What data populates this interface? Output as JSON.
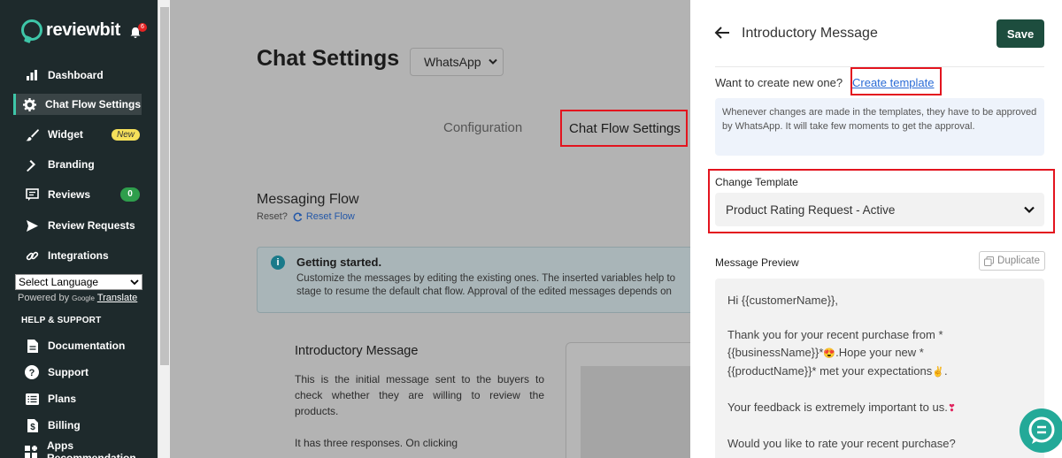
{
  "brand": {
    "name": "reviewbit",
    "notification_count": "6",
    "accent": "#3ec6a8"
  },
  "sidebar": {
    "items": [
      {
        "label": "Dashboard",
        "icon": "bar-chart-icon"
      },
      {
        "label": "Chat Flow Settings",
        "icon": "gear-icon"
      },
      {
        "label": "Widget",
        "icon": "brush-icon",
        "badge": "New"
      },
      {
        "label": "Branding",
        "icon": "hammer-icon"
      },
      {
        "label": "Reviews",
        "icon": "review-icon",
        "badge": "0"
      },
      {
        "label": "Review Requests",
        "icon": "send-icon"
      },
      {
        "label": "Integrations",
        "icon": "link-icon"
      }
    ],
    "language_select": "Select Language",
    "powered_by": "Powered by",
    "google": "Google",
    "translate": "Translate",
    "help_heading": "HELP & SUPPORT",
    "help_items": [
      {
        "label": "Documentation",
        "icon": "document-icon"
      },
      {
        "label": "Support",
        "icon": "help-icon"
      },
      {
        "label": "Plans",
        "icon": "list-icon"
      },
      {
        "label": "Billing",
        "icon": "dollar-icon"
      },
      {
        "label": "Apps Recommendation",
        "icon": "apps-icon"
      }
    ]
  },
  "main": {
    "title": "Chat Settings",
    "channel_select": "WhatsApp",
    "tabs": [
      {
        "label": "Configuration"
      },
      {
        "label": "Chat Flow Settings"
      }
    ],
    "section_title": "Messaging Flow",
    "reset_prefix": "Reset?",
    "reset_link": "Reset Flow",
    "info_title": "Getting started.",
    "info_line1": "Customize the messages by editing the existing ones. The inserted variables help to",
    "info_line2": "stage to resume the default chat flow. Approval of the edited messages depends on",
    "intro_title": "Introductory Message",
    "intro_text": "This is the initial message sent to the buyers to check whether they are willing to review the products.",
    "intro_text2": "It has three responses. On clicking"
  },
  "drawer": {
    "title": "Introductory Message",
    "save_label": "Save",
    "create_prompt": "Want to create new one?",
    "create_link": "Create template",
    "notice": "Whenever changes are made in the templates, they have to be approved by WhatsApp. It will take few moments to get the approval.",
    "template_label": "Change Template",
    "template_value": "Product Rating Request - Active",
    "preview_label": "Message Preview",
    "duplicate_label": "Duplicate",
    "preview": {
      "greeting": "Hi {{customerName}},",
      "line1a": "Thank you for your recent purchase from *",
      "line1b": "{{businessName}}*",
      "line1c": ".Hope your new *",
      "line1d": "{{productName}}* met your expectations",
      "line1e": ".",
      "line2": "Your feedback is extremely important to us.",
      "line3": "Would you like to rate your recent purchase?"
    }
  }
}
